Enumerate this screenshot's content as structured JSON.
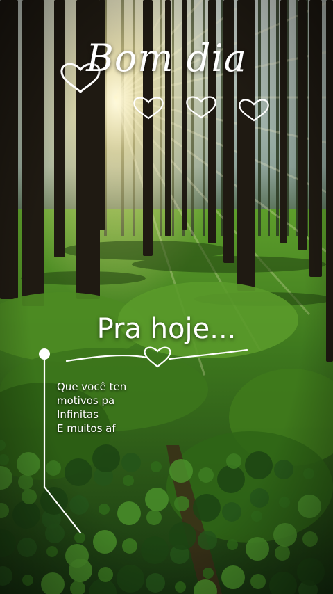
{
  "greeting": {
    "title": "Bom dia"
  },
  "heading": {
    "text": "Pra hoje..."
  },
  "message": {
    "lines": [
      "Que você tenha",
      "motivos para",
      "Infinitas",
      "E muitos afeto"
    ],
    "visible": [
      "Que você ten",
      "motivos pa",
      "Infinitas",
      "E muitos af"
    ]
  },
  "colors": {
    "text": "#ffffff",
    "grass": "#4f8f23",
    "sun": "#fff6c8"
  }
}
